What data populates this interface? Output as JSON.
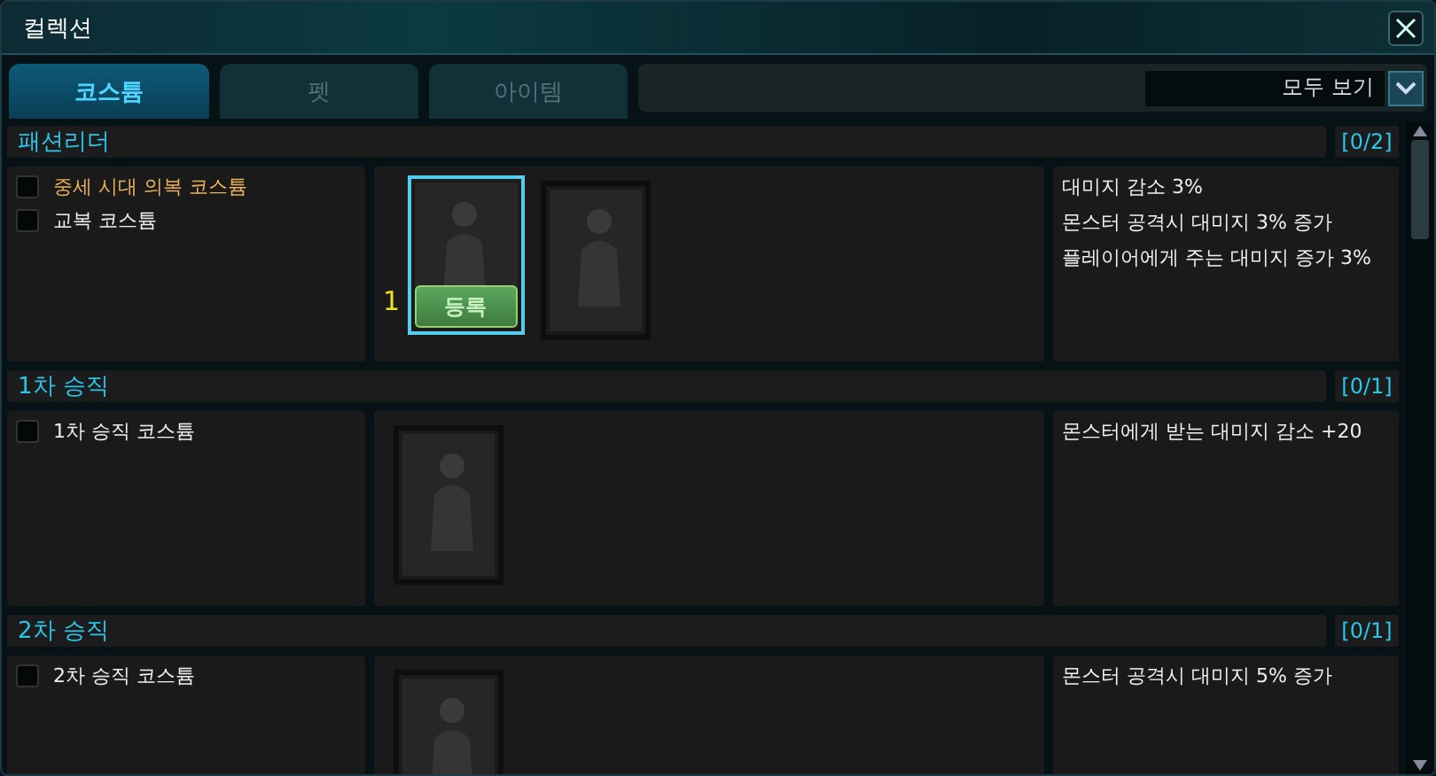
{
  "window": {
    "title": "컬렉션"
  },
  "tabs": [
    {
      "label": "코스튬",
      "selected": true
    },
    {
      "label": "펫",
      "selected": false
    },
    {
      "label": "아이템",
      "selected": false
    }
  ],
  "filter": {
    "value": "모두 보기"
  },
  "sections": [
    {
      "title": "패션리더",
      "count": "[0/2]",
      "items": [
        {
          "label": "중세 시대 의복 코스튬",
          "checked": false,
          "available": true
        },
        {
          "label": "교복 코스튬",
          "checked": false,
          "available": false
        }
      ],
      "cards": [
        {
          "selected": true,
          "quantity": "1",
          "button": "등록"
        },
        {
          "selected": false
        }
      ],
      "effects": [
        "대미지 감소 3%",
        "몬스터 공격시 대미지 3% 증가",
        "플레이어에게 주는 대미지 증가 3%"
      ]
    },
    {
      "title": "1차 승직",
      "count": "[0/1]",
      "items": [
        {
          "label": "1차 승직 코스튬",
          "checked": false,
          "available": false
        }
      ],
      "cards": [
        {
          "selected": false
        }
      ],
      "effects": [
        "몬스터에게 받는 대미지 감소 +20"
      ]
    },
    {
      "title": "2차 승직",
      "count": "[0/1]",
      "items": [
        {
          "label": "2차 승직 코스튬",
          "checked": false,
          "available": false
        }
      ],
      "cards": [
        {
          "selected": false
        }
      ],
      "effects": [
        "몬스터 공격시 대미지 5% 증가"
      ]
    }
  ]
}
